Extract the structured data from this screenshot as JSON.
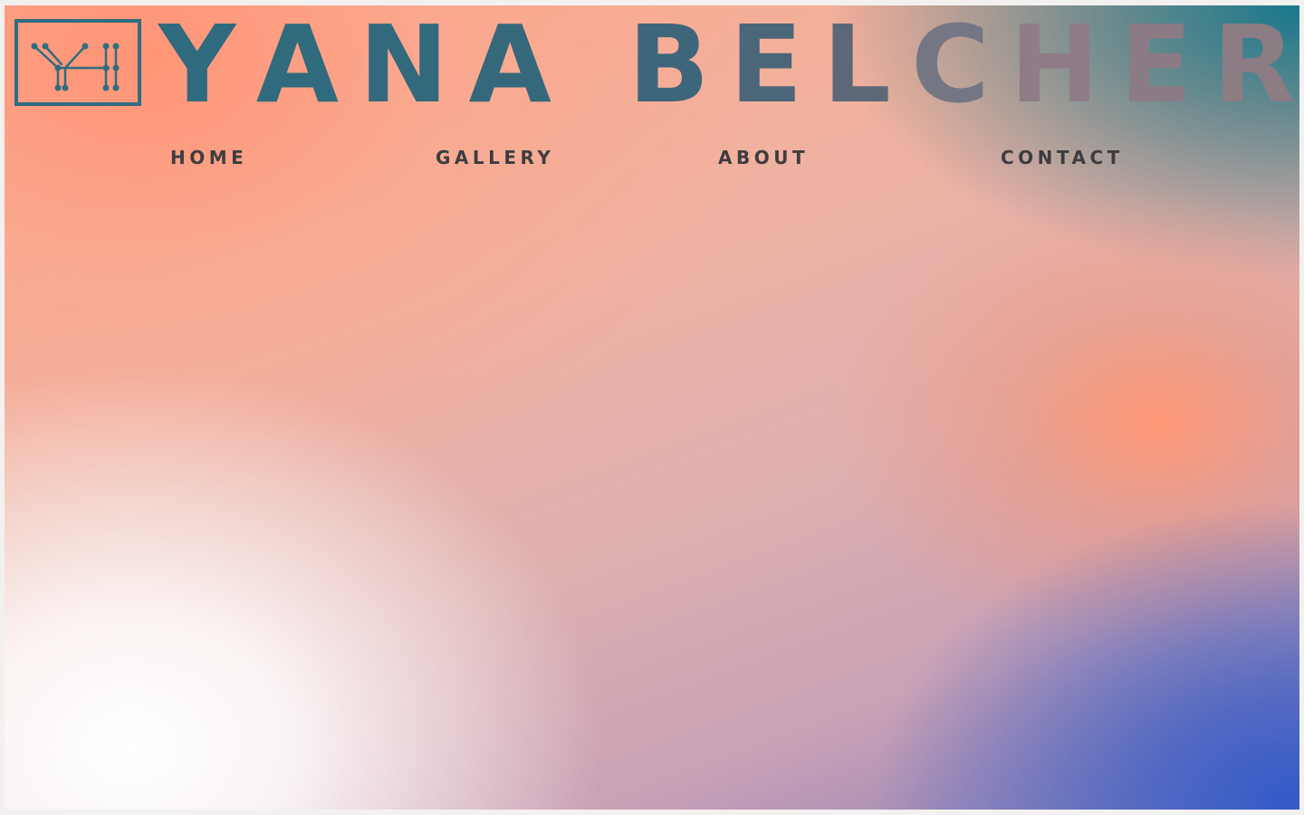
{
  "brand": {
    "logo_icon": "yh-monogram-icon",
    "name_letters": [
      "Y",
      "A",
      "N",
      "A",
      " ",
      "B",
      "E",
      "L",
      "C",
      "H",
      "E",
      "R"
    ],
    "colors": {
      "teal": "#2f6a7e",
      "slate": "#5d6876",
      "mauve": "#8f7c86"
    }
  },
  "nav": {
    "home": "HOME",
    "gallery": "GALLERY",
    "about": "ABOUT",
    "contact": "CONTACT",
    "text_color": "#3d3d40"
  }
}
